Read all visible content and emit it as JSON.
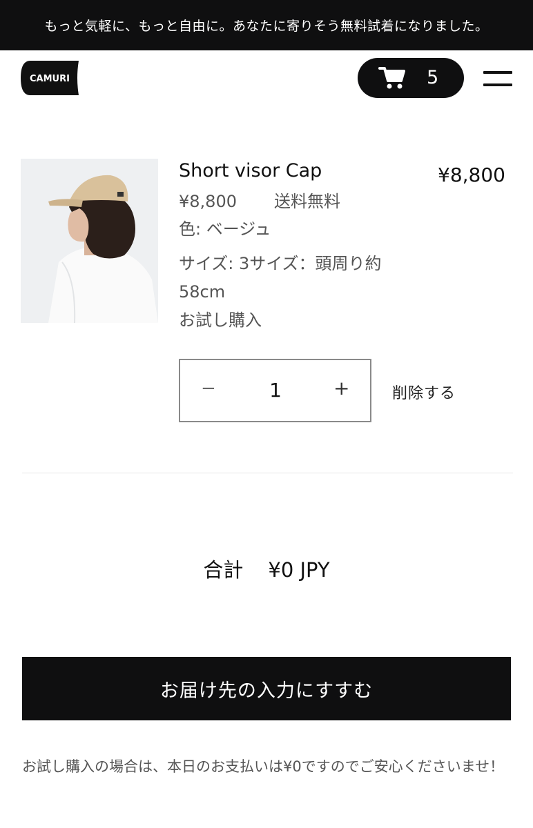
{
  "announcement": {
    "text": "もっと気軽に、もっと自由に。あなたに寄りそう無料試着になりました。"
  },
  "header": {
    "logo_text": "CAMURI",
    "cart_count": "5"
  },
  "cart": {
    "item": {
      "name": "Short visor Cap",
      "unit_price": "¥8,800",
      "shipping": "送料無料",
      "color": "色: ベージュ",
      "size": "サイズ: 3サイズ：頭周り約58cm",
      "plan": "お試し購入",
      "line_price": "¥8,800",
      "quantity": "1",
      "remove_label": "削除する"
    },
    "total_label": "合計",
    "total_value": "¥0 JPY",
    "checkout_label": "お届け先の入力にすすむ",
    "note": "お試し購入の場合は、本日のお支払いは¥0ですのでご安心くださいませ！"
  },
  "colors": {
    "dark": "#0f0f10",
    "text_secondary": "#555555",
    "divider": "#e6e6e6"
  }
}
